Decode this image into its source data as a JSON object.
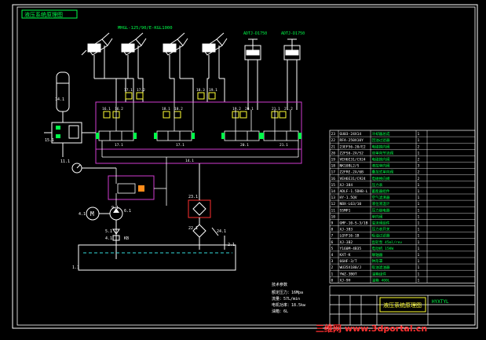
{
  "drawing": {
    "title_stamp": "液压系统原理图",
    "part_number": "HYXTYL",
    "cylinders_label": "MHGL-125/90/E-KGL1000",
    "actuator_label_1": "ADTJ-D1750",
    "actuator_label_2": "ADTJ-D1750",
    "title_block_name": "液压系统原理图",
    "watermark": "三维网 www.3dportal.cn"
  },
  "component_labels": {
    "accumulator": "14.1",
    "pressure_gauge": "15.1",
    "gauge_switch": "11.1",
    "motor": "M",
    "motor_tag": "4.1",
    "pump_tag": "6.1",
    "pump_group": "5.1",
    "coupling": "3.1",
    "filter": "4.1",
    "check": "KB",
    "tank": "1.1",
    "manifold_main": "14.1",
    "relief_block": "9.1",
    "cooler": "23.1",
    "return_filter": "22.1",
    "return_check": "24.1",
    "tank_cap": "2.1",
    "valve_tags": [
      "16.1",
      "16.2",
      "17.1",
      "17.2",
      "18.1",
      "18.2",
      "18.3",
      "19.1",
      "19.2",
      "20.1",
      "21.1",
      "21.2"
    ],
    "valve_group_tags": [
      "17.1",
      "17.1",
      "20.1",
      "21.1"
    ]
  },
  "notes": {
    "heading": "技术参数",
    "lines": [
      "额定压力：16Mpa",
      "流量：57L/min",
      "电机功率：18.5kw",
      "油箱：6L"
    ]
  },
  "bom": {
    "rows": [
      [
        "23",
        "GU03-24X14",
        "冷却器总成",
        "1",
        ""
      ],
      [
        "22",
        "RFA-250X10Y",
        "回油过滤器",
        "1",
        ""
      ],
      [
        "21",
        "23EF56-20/E2",
        "电磁换向阀",
        "2",
        ""
      ],
      [
        "20",
        "Z2FS6-2X/S2",
        "双单向节流阀",
        "1",
        ""
      ],
      [
        "19",
        "VEH6E31/C924",
        "电磁换向阀",
        "2",
        ""
      ],
      [
        "18",
        "NK10BL2/S",
        "液控单向阀",
        "3",
        ""
      ],
      [
        "17",
        "Z2FRE-2X/6B",
        "叠加式单向阀",
        "2",
        ""
      ],
      [
        "16",
        "VEH6E31/C924",
        "电磁换向阀",
        "2",
        ""
      ],
      [
        "15",
        "XJ-384",
        "压力表",
        "1",
        ""
      ],
      [
        "14",
        "ADLF-1.5DHB-L",
        "蓄能器组件",
        "1",
        ""
      ],
      [
        "13",
        "HY-1.5QV",
        "空气滤清器",
        "1",
        ""
      ],
      [
        "12",
        "NBX-L63/10",
        "液位液温计",
        "1",
        ""
      ],
      [
        "11",
        "SSMP1",
        "压力继电器",
        "1",
        ""
      ],
      [
        "10",
        "",
        "单向阀",
        "1",
        ""
      ],
      [
        "9",
        "GMF-10-S-3/1B",
        "溢流阀组件",
        "1",
        ""
      ],
      [
        "8",
        "XJ-3B3",
        "压力表开关",
        "1",
        ""
      ],
      [
        "7",
        "LQYF16-1B",
        "吸油过滤器",
        "1",
        ""
      ],
      [
        "6",
        "XJ-3B2",
        "齿轮泵 45ml/rev",
        "1",
        ""
      ],
      [
        "5",
        "Y160M-4B35",
        "电动机 15KW",
        "1",
        ""
      ],
      [
        "4",
        "KXT-K",
        "联轴器",
        "1",
        ""
      ],
      [
        "3",
        "66HF-3/T",
        "钟形罩",
        "1",
        ""
      ],
      [
        "2",
        "WU35X180/J",
        "吸油滤油器",
        "1",
        ""
      ],
      [
        "1",
        "YWZ-3B0T",
        "油箱组件",
        "1",
        ""
      ],
      [
        "0",
        "XJ-9H",
        "油箱 400L",
        "1",
        ""
      ]
    ],
    "header": [
      "序号",
      "代号",
      "名称",
      "数量",
      "备注"
    ]
  },
  "colors": {
    "line": "#ffffff",
    "green": "#00ff4a",
    "magenta": "#d13cd1",
    "yellow": "#ffff33",
    "red": "#ff3030",
    "cyan": "#33dddd",
    "frame": "#ffffff"
  }
}
